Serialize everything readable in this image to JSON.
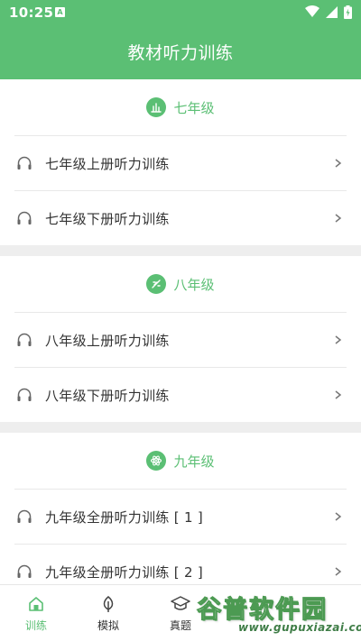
{
  "status_bar": {
    "time": "10:25",
    "notif_letter": "A"
  },
  "header": {
    "title": "教材听力训练"
  },
  "sections": [
    {
      "grade": "七年级",
      "items": [
        "七年级上册听力训练",
        "七年级下册听力训练"
      ]
    },
    {
      "grade": "八年级",
      "items": [
        "八年级上册听力训练",
        "八年级下册听力训练"
      ]
    },
    {
      "grade": "九年级",
      "items": [
        "九年级全册听力训练 [ 1 ]",
        "九年级全册听力训练 [ 2 ]"
      ]
    }
  ],
  "tabs": [
    {
      "label": "训练",
      "icon": "home-icon",
      "active": true
    },
    {
      "label": "模拟",
      "icon": "leaf-icon",
      "active": false
    },
    {
      "label": "真题",
      "icon": "graduation-cap-icon",
      "active": false
    }
  ],
  "watermark": {
    "title": "谷普软件园",
    "url": "www.gupuxiazai.com"
  },
  "colors": {
    "accent": "#5bbf74",
    "separator": "#eeeeee",
    "text": "#333333"
  }
}
